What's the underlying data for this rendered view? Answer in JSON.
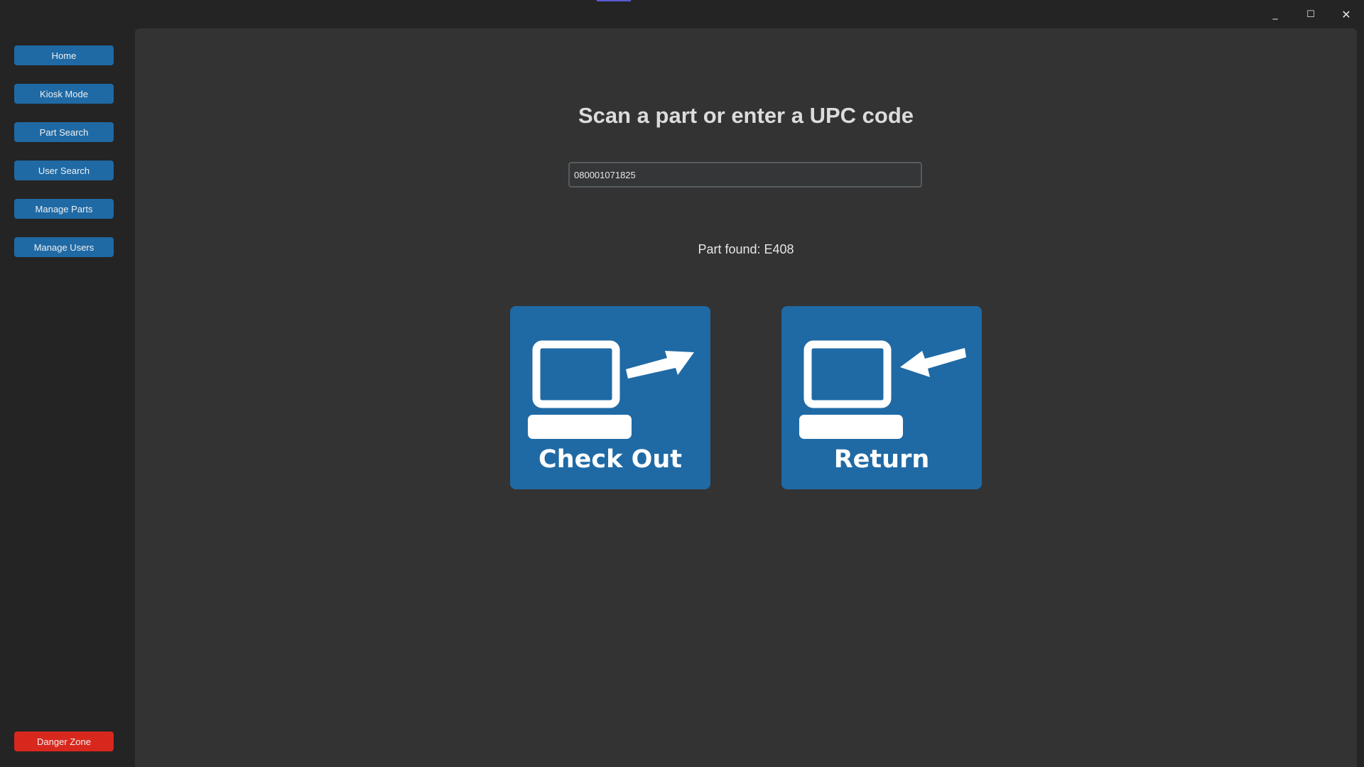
{
  "window": {
    "controls": {
      "minimize_icon": "minimize-icon",
      "maximize_icon": "maximize-icon",
      "close_icon": "close-icon",
      "minimize_glyph": "_",
      "maximize_glyph": "☐",
      "close_glyph": "✕"
    }
  },
  "sidebar": {
    "items": [
      {
        "label": "Home"
      },
      {
        "label": "Kiosk Mode"
      },
      {
        "label": "Part Search"
      },
      {
        "label": "User Search"
      },
      {
        "label": "Manage Parts"
      },
      {
        "label": "Manage Users"
      }
    ],
    "danger_label": "Danger Zone"
  },
  "main": {
    "heading": "Scan a part or enter a UPC code",
    "upc_value": "080001071825",
    "status": "Part found: E408",
    "actions": [
      {
        "label": "Check Out",
        "icon": "computer-arrow-out-icon"
      },
      {
        "label": "Return",
        "icon": "computer-arrow-in-icon"
      }
    ]
  },
  "colors": {
    "accent": "#1f6aa5",
    "danger": "#d8281e",
    "panel": "#333333",
    "background": "#242424"
  }
}
